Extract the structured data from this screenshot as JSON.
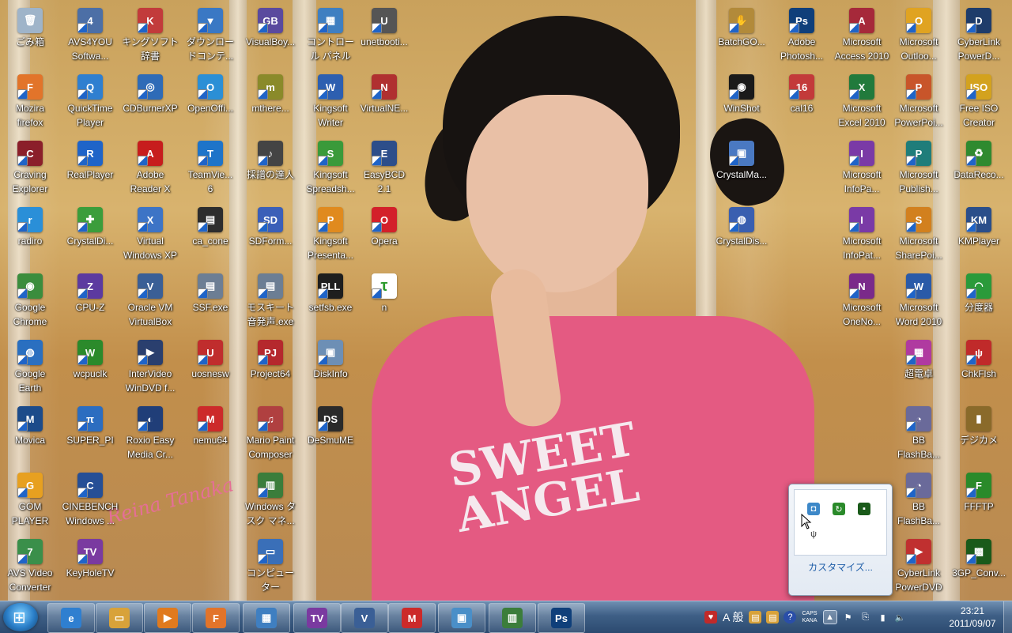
{
  "signature": "Reina Tanaka",
  "shirt_print": "SWEET\nANGEL",
  "icons": [
    {
      "label": "ごみ箱",
      "glyph": "🗑",
      "color": "#9fb4c9",
      "shortcut": false
    },
    {
      "label": "AVS4YOU\nSoftwa...",
      "glyph": "4",
      "color": "#4c6fa6",
      "shortcut": true
    },
    {
      "label": "キングソフト\n辞書",
      "glyph": "K",
      "color": "#c23b3b",
      "shortcut": true
    },
    {
      "label": "ダウンロー\nドコンテ...",
      "glyph": "▼",
      "color": "#3a78c4",
      "shortcut": true
    },
    {
      "label": "VisualBoy...",
      "glyph": "GB",
      "color": "#5a4a9e",
      "shortcut": true
    },
    {
      "label": "コントロー\nル パネル",
      "glyph": "▦",
      "color": "#3f7fc1",
      "shortcut": true
    },
    {
      "label": "unetbooti...",
      "glyph": "U",
      "color": "#555555",
      "shortcut": true
    },
    {
      "label": "Mozira\nfirefox",
      "glyph": "F",
      "color": "#e2742a",
      "shortcut": true
    },
    {
      "label": "QuickTime\nPlayer",
      "glyph": "Q",
      "color": "#2f7fd0",
      "shortcut": true
    },
    {
      "label": "CDBurnerXP",
      "glyph": "◎",
      "color": "#2e6bb7",
      "shortcut": true
    },
    {
      "label": "OpenOffi...",
      "glyph": "O",
      "color": "#2b8fd6",
      "shortcut": true
    },
    {
      "label": "mthere...",
      "glyph": "m",
      "color": "#8a8a2a",
      "shortcut": true
    },
    {
      "label": "Kingsoft\nWriter",
      "glyph": "W",
      "color": "#2d5fb0",
      "shortcut": true
    },
    {
      "label": "VirtualNE...",
      "glyph": "N",
      "color": "#b03030",
      "shortcut": true
    },
    {
      "label": "Craving\nExplorer",
      "glyph": "C",
      "color": "#8b1f2a",
      "shortcut": true
    },
    {
      "label": "RealPlayer",
      "glyph": "R",
      "color": "#1f64c8",
      "shortcut": true
    },
    {
      "label": "Adobe\nReader X",
      "glyph": "A",
      "color": "#c71d1d",
      "shortcut": true
    },
    {
      "label": "TeamVie...\n6",
      "glyph": "T",
      "color": "#1e74c9",
      "shortcut": true
    },
    {
      "label": "採譜の達人",
      "glyph": "♪",
      "color": "#444444",
      "shortcut": true
    },
    {
      "label": "Kingsoft\nSpreadsh...",
      "glyph": "S",
      "color": "#3a9a3a",
      "shortcut": true
    },
    {
      "label": "EasyBCD\n2.1",
      "glyph": "E",
      "color": "#2d4e8a",
      "shortcut": true
    },
    {
      "label": "radiro",
      "glyph": "r",
      "color": "#2a8fd8",
      "shortcut": true
    },
    {
      "label": "CrystalDi...",
      "glyph": "✚",
      "color": "#3b9d3b",
      "shortcut": true
    },
    {
      "label": "Virtual\nWindows XP",
      "glyph": "X",
      "color": "#3d74c6",
      "shortcut": true
    },
    {
      "label": "ca_cone",
      "glyph": "▤",
      "color": "#2d2d2d",
      "shortcut": true
    },
    {
      "label": "SDForm...",
      "glyph": "SD",
      "color": "#3b5fb8",
      "shortcut": true
    },
    {
      "label": "Kingsoft\nPresenta...",
      "glyph": "P",
      "color": "#e08a1e",
      "shortcut": true
    },
    {
      "label": "Opera",
      "glyph": "O",
      "color": "#d3202a",
      "shortcut": true
    },
    {
      "label": "Google\nChrome",
      "glyph": "◉",
      "color": "#3b8d3d",
      "shortcut": true
    },
    {
      "label": "CPU-Z",
      "glyph": "Z",
      "color": "#5c3aa0",
      "shortcut": true
    },
    {
      "label": "Oracle VM\nVirtualBox",
      "glyph": "V",
      "color": "#3a5f96",
      "shortcut": true
    },
    {
      "label": "SSF.exe",
      "glyph": "▤",
      "color": "#6c7e94",
      "shortcut": true
    },
    {
      "label": "モスキート\n音発声.exe",
      "glyph": "▤",
      "color": "#6c7e94",
      "shortcut": true
    },
    {
      "label": "setfsb.exe",
      "glyph": "PLL",
      "color": "#1e1e1e",
      "shortcut": true
    },
    {
      "label": "n",
      "glyph": "τ",
      "color": "#ffffff",
      "shortcut": true
    },
    {
      "label": "Google\nEarth",
      "glyph": "◍",
      "color": "#2a6fc0",
      "shortcut": true
    },
    {
      "label": "wcpuclk",
      "glyph": "W",
      "color": "#2b8a2b",
      "shortcut": true
    },
    {
      "label": "InterVideo\nWinDVD f...",
      "glyph": "▶",
      "color": "#2a3f6e",
      "shortcut": true
    },
    {
      "label": "uosnesw",
      "glyph": "U",
      "color": "#c02d2d",
      "shortcut": true
    },
    {
      "label": "Project64",
      "glyph": "PJ",
      "color": "#b5282d",
      "shortcut": true
    },
    {
      "label": "DiskInfo",
      "glyph": "▣",
      "color": "#6d8fb5",
      "shortcut": true
    },
    {
      "label": "Movica",
      "glyph": "M",
      "color": "#1c4b8a",
      "shortcut": true
    },
    {
      "label": "SUPER_PI",
      "glyph": "π",
      "color": "#2c6dc0",
      "shortcut": true
    },
    {
      "label": "Roxio Easy\nMedia Cr...",
      "glyph": "◐",
      "color": "#203e78",
      "shortcut": true
    },
    {
      "label": "nemu64",
      "glyph": "M",
      "color": "#cc2a2a",
      "shortcut": true
    },
    {
      "label": "Mario Paint\nComposer",
      "glyph": "♫",
      "color": "#b04040",
      "shortcut": true
    },
    {
      "label": "DeSmuME",
      "glyph": "DS",
      "color": "#2a2a2a",
      "shortcut": true
    },
    {
      "label": "GOM\nPLAYER",
      "glyph": "G",
      "color": "#e7a020",
      "shortcut": true
    },
    {
      "label": "CINEBENCH\nWindows ...",
      "glyph": "C",
      "color": "#264f96",
      "shortcut": true
    },
    {
      "label": "Windows タ\nスク マネ...",
      "glyph": "▥",
      "color": "#3b7d3b",
      "shortcut": true
    },
    {
      "label": "AVS Video\nConverter",
      "glyph": "7",
      "color": "#3a8f4a",
      "shortcut": true
    },
    {
      "label": "KeyHoleTV",
      "glyph": "TV",
      "color": "#7a3aa0",
      "shortcut": true
    },
    {
      "label": "コンピュー\nター",
      "glyph": "▭",
      "color": "#3a6fb8",
      "shortcut": true
    },
    {
      "label": "BatchGO...",
      "glyph": "✋",
      "color": "#b28a3a",
      "shortcut": true
    },
    {
      "label": "Adobe\nPhotosh...",
      "glyph": "Ps",
      "color": "#0f3f7a",
      "shortcut": true
    },
    {
      "label": "Microsoft\nAccess 2010",
      "glyph": "A",
      "color": "#a6293a",
      "shortcut": true
    },
    {
      "label": "Microsoft\nOutloo...",
      "glyph": "O",
      "color": "#e0a321",
      "shortcut": true
    },
    {
      "label": "CyberLink\nPowerD...",
      "glyph": "D",
      "color": "#1e3c6a",
      "shortcut": true
    },
    {
      "label": "WinShot",
      "glyph": "◉",
      "color": "#1a1a1a",
      "shortcut": true
    },
    {
      "label": "cal16",
      "glyph": "16",
      "color": "#c33a3a",
      "shortcut": true
    },
    {
      "label": "Microsoft\nExcel 2010",
      "glyph": "X",
      "color": "#217a3c",
      "shortcut": true
    },
    {
      "label": "Microsoft\nPowerPoi...",
      "glyph": "P",
      "color": "#c8552a",
      "shortcut": true
    },
    {
      "label": "Free ISO\nCreator",
      "glyph": "ISO",
      "color": "#d3a21e",
      "shortcut": true
    },
    {
      "label": "CrystalMa...",
      "glyph": "▣",
      "color": "#4a79c2",
      "shortcut": true
    },
    {
      "label": "Microsoft\nInfoPa...",
      "glyph": "I",
      "color": "#7a3aa6",
      "shortcut": true
    },
    {
      "label": "Microsoft\nPublish...",
      "glyph": "P",
      "color": "#1f7d7a",
      "shortcut": true
    },
    {
      "label": "DataReco...",
      "glyph": "♻",
      "color": "#2f8a2f",
      "shortcut": true
    },
    {
      "label": "CrystalDis...",
      "glyph": "◍",
      "color": "#3a5fb0",
      "shortcut": true
    },
    {
      "label": "Microsoft\nInfoPat...",
      "glyph": "I",
      "color": "#7a3aa6",
      "shortcut": true
    },
    {
      "label": "Microsoft\nSharePoi...",
      "glyph": "S",
      "color": "#d2801e",
      "shortcut": true
    },
    {
      "label": "KMPlayer",
      "glyph": "KM",
      "color": "#2a4e8a",
      "shortcut": true
    },
    {
      "label": "Microsoft\nOneNo...",
      "glyph": "N",
      "color": "#7a2a8a",
      "shortcut": true
    },
    {
      "label": "Microsoft\nWord 2010",
      "glyph": "W",
      "color": "#2a5aa8",
      "shortcut": true
    },
    {
      "label": "分度器",
      "glyph": "◠",
      "color": "#2a9a3a",
      "shortcut": true
    },
    {
      "label": "超電卓",
      "glyph": "▦",
      "color": "#b03aa0",
      "shortcut": true
    },
    {
      "label": "ChkFlsh",
      "glyph": "ψ",
      "color": "#c02a2a",
      "shortcut": true
    },
    {
      "label": "BB\nFlashBa...",
      "glyph": "◔",
      "color": "#6a6a9a",
      "shortcut": true
    },
    {
      "label": "デジカメ",
      "glyph": "▮",
      "color": "#8a6a2a",
      "shortcut": false
    },
    {
      "label": "BB\nFlashBa...",
      "glyph": "◔",
      "color": "#6a6a9a",
      "shortcut": true
    },
    {
      "label": "FFFTP",
      "glyph": "F",
      "color": "#2a8a2a",
      "shortcut": true
    },
    {
      "label": "CyberLink\nPowerDVD",
      "glyph": "▶",
      "color": "#c03030",
      "shortcut": true
    },
    {
      "label": "3GP_Conv...",
      "glyph": "▩",
      "color": "#1a5a1a",
      "shortcut": true
    }
  ],
  "tray_popup": {
    "customize_label": "カスタマイズ..."
  },
  "taskbar": {
    "apps": [
      {
        "name": "internet-explorer",
        "glyph": "e",
        "color": "#2f7fd0"
      },
      {
        "name": "explorer",
        "glyph": "▭",
        "color": "#d8a23a"
      },
      {
        "name": "media-player",
        "glyph": "▶",
        "color": "#e07a1e"
      },
      {
        "name": "firefox",
        "glyph": "F",
        "color": "#e2742a"
      },
      {
        "name": "control-panel",
        "glyph": "▦",
        "color": "#3f7fc1"
      },
      {
        "name": "keyholetv",
        "glyph": "TV",
        "color": "#7a3aa0"
      },
      {
        "name": "virtualbox",
        "glyph": "V",
        "color": "#3a5f96"
      },
      {
        "name": "mario",
        "glyph": "M",
        "color": "#cc2a2a"
      },
      {
        "name": "image-viewer",
        "glyph": "▣",
        "color": "#4a8fc8"
      },
      {
        "name": "task-manager",
        "glyph": "▥",
        "color": "#3b7d3b"
      },
      {
        "name": "photoshop",
        "glyph": "Ps",
        "color": "#0f3f7a"
      }
    ],
    "ime_label": "A 般",
    "caps_label": "CAPS",
    "kana_label": "KANA",
    "time": "23:21",
    "date": "2011/09/07"
  }
}
